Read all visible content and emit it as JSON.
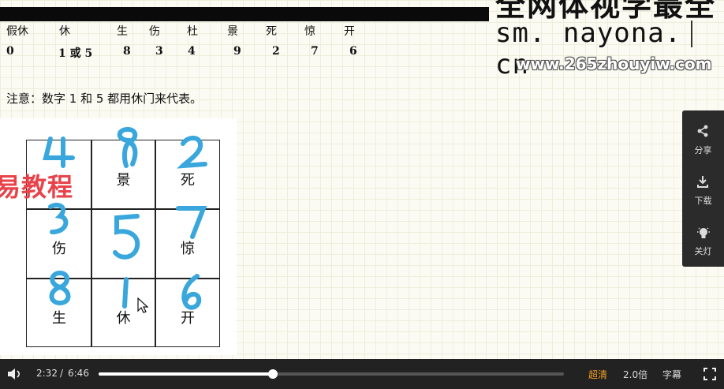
{
  "table": {
    "headers": [
      "假休",
      "休",
      "生",
      "伤",
      "杜",
      "景",
      "死",
      "惊",
      "开"
    ],
    "values": [
      "0",
      "1 或 5",
      "8",
      "3",
      "4",
      "9",
      "2",
      "7",
      "6"
    ]
  },
  "note": "注意：数字 1 和 5 都用休门来代表。",
  "watermark": {
    "top_text": "全网体视学最全",
    "site": "sm. nayona. cn",
    "url": "www.265zhouyiw.com",
    "red_text": "易教程"
  },
  "grid": {
    "cells": [
      {
        "label": "",
        "digit": "4"
      },
      {
        "label": "景",
        "digit": "9"
      },
      {
        "label": "死",
        "digit": "2"
      },
      {
        "label": "伤",
        "digit": "3"
      },
      {
        "label": "",
        "digit": "5"
      },
      {
        "label": "惊",
        "digit": "7"
      },
      {
        "label": "生",
        "digit": "8"
      },
      {
        "label": "休",
        "digit": "1"
      },
      {
        "label": "开",
        "digit": "6"
      }
    ]
  },
  "side_panel": {
    "share": "分享",
    "download": "下载",
    "lights_off": "关灯"
  },
  "player": {
    "current_time": "2:32",
    "separator": "/",
    "duration": "6:46",
    "progress_fraction": 0.374,
    "quality": "超清",
    "speed": "2.0倍",
    "subtitles": "字幕",
    "quality_color": "#f0a020"
  }
}
